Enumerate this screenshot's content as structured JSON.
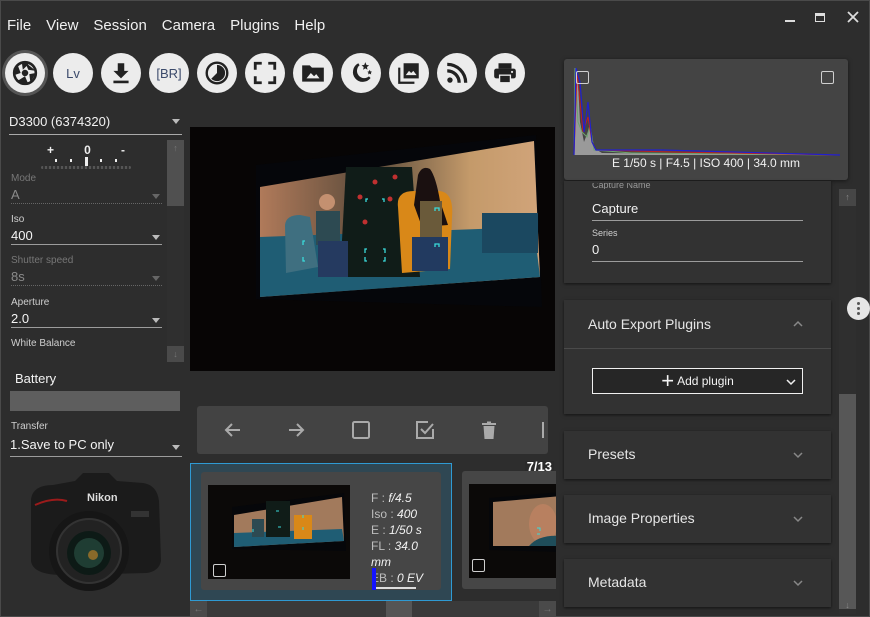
{
  "menu": [
    "File",
    "View",
    "Session",
    "Camera",
    "Plugins",
    "Help"
  ],
  "window_controls": {
    "minimize": "minimize-icon",
    "maximize": "maximize-icon",
    "close": "close-icon"
  },
  "toolbar": [
    {
      "name": "capture-button",
      "icon": "aperture-icon",
      "label": ""
    },
    {
      "name": "live-view-button",
      "icon": "",
      "label": "Lv"
    },
    {
      "name": "download-button",
      "icon": "download-icon",
      "label": ""
    },
    {
      "name": "bracketing-button",
      "icon": "",
      "label": "[BR]"
    },
    {
      "name": "timelapse-button",
      "icon": "timer-icon",
      "label": ""
    },
    {
      "name": "fullscreen-button",
      "icon": "fullscreen-icon",
      "label": ""
    },
    {
      "name": "open-folder-button",
      "icon": "image-folder-icon",
      "label": ""
    },
    {
      "name": "astro-button",
      "icon": "moon-stars-icon",
      "label": ""
    },
    {
      "name": "gallery-button",
      "icon": "photo-library-icon",
      "label": ""
    },
    {
      "name": "wireless-button",
      "icon": "rss-icon",
      "label": ""
    },
    {
      "name": "print-button",
      "icon": "printer-icon",
      "label": ""
    }
  ],
  "left": {
    "camera": "D3300 (6374320)",
    "ev_scale": {
      "plus": "+",
      "zero": "0",
      "minus": "-"
    },
    "props": [
      {
        "label": "Mode",
        "value": "A",
        "enabled": false
      },
      {
        "label": "Iso",
        "value": "400",
        "enabled": true
      },
      {
        "label": "Shutter speed",
        "value": "8s",
        "enabled": false
      },
      {
        "label": "Aperture",
        "value": "2.0",
        "enabled": true
      }
    ],
    "white_balance_label": "White Balance",
    "battery_label": "Battery",
    "battery_level": 0,
    "transfer": {
      "label": "Transfer",
      "value": "1.Save to PC only"
    }
  },
  "nav_toolbar": [
    "arrow-left-icon",
    "arrow-right-icon",
    "checkbox-empty-icon",
    "checkbox-checked-icon",
    "trash-icon"
  ],
  "thumbnails": {
    "counter": "7/13",
    "selected": {
      "f_label": "F : ",
      "f_value": "f/4.5",
      "iso_label": "Iso : ",
      "iso_value": "400",
      "e_label": "E : ",
      "e_value": "1/50 s",
      "fl_label": "FL : ",
      "fl_value": "34.0 mm",
      "eb_label": "EB : ",
      "eb_value": "0 EV"
    }
  },
  "histogram": {
    "caption": "E 1/50 s | F4.5 | ISO 400 | 34.0 mm"
  },
  "session_panel": {
    "capture_name_label": "Capture Name",
    "capture_name_value": "Capture",
    "series_label": "Series",
    "series_value": "0"
  },
  "auto_export": {
    "title": "Auto Export Plugins",
    "add_label": "Add plugin"
  },
  "collapsed_panels": [
    "Presets",
    "Image Properties",
    "Metadata"
  ],
  "colors": {
    "accent": "#2f9ad3",
    "background": "#2d2d2d",
    "panel": "#323232"
  }
}
